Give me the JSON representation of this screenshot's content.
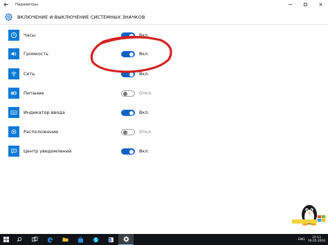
{
  "window": {
    "title": "Параметры",
    "back_icon": "back-arrow-icon",
    "controls": [
      "minimize-icon",
      "maximize-icon",
      "close-icon"
    ]
  },
  "page": {
    "title": "ВКЛЮЧЕНИЕ И ВЫКЛЮЧЕНИЕ СИСТЕМНЫХ ЗНАЧКОВ",
    "icon": "gear-icon"
  },
  "colors": {
    "accent": "#0a7ad7",
    "toggle_on": "#0a62c8",
    "annotation": "#d42020",
    "taskbar": "#101418"
  },
  "items": [
    {
      "label": "Часы",
      "state": "Вкл.",
      "on": true,
      "icon": "clock-icon"
    },
    {
      "label": "Громкость",
      "state": "Вкл.",
      "on": true,
      "icon": "speaker-icon"
    },
    {
      "label": "Сеть",
      "state": "Вкл.",
      "on": true,
      "icon": "network-icon"
    },
    {
      "label": "Питание",
      "state": "Откл.",
      "on": false,
      "icon": "battery-icon"
    },
    {
      "label": "Индикатор ввода",
      "state": "Вкл.",
      "on": true,
      "icon": "keyboard-icon"
    },
    {
      "label": "Расположение",
      "state": "Откл.",
      "on": false,
      "icon": "location-icon"
    },
    {
      "label": "Центр уведомлений",
      "state": "Вкл.",
      "on": true,
      "icon": "action-center-icon"
    }
  ],
  "taskbar": {
    "icons": [
      "windows-start-icon",
      "search-icon",
      "task-view-icon",
      "edge-icon",
      "file-explorer-icon",
      "store-icon",
      "skype-icon",
      "word-icon",
      "settings-icon"
    ],
    "language": "ENG",
    "time": "22:13",
    "date": "16.05.2016"
  }
}
